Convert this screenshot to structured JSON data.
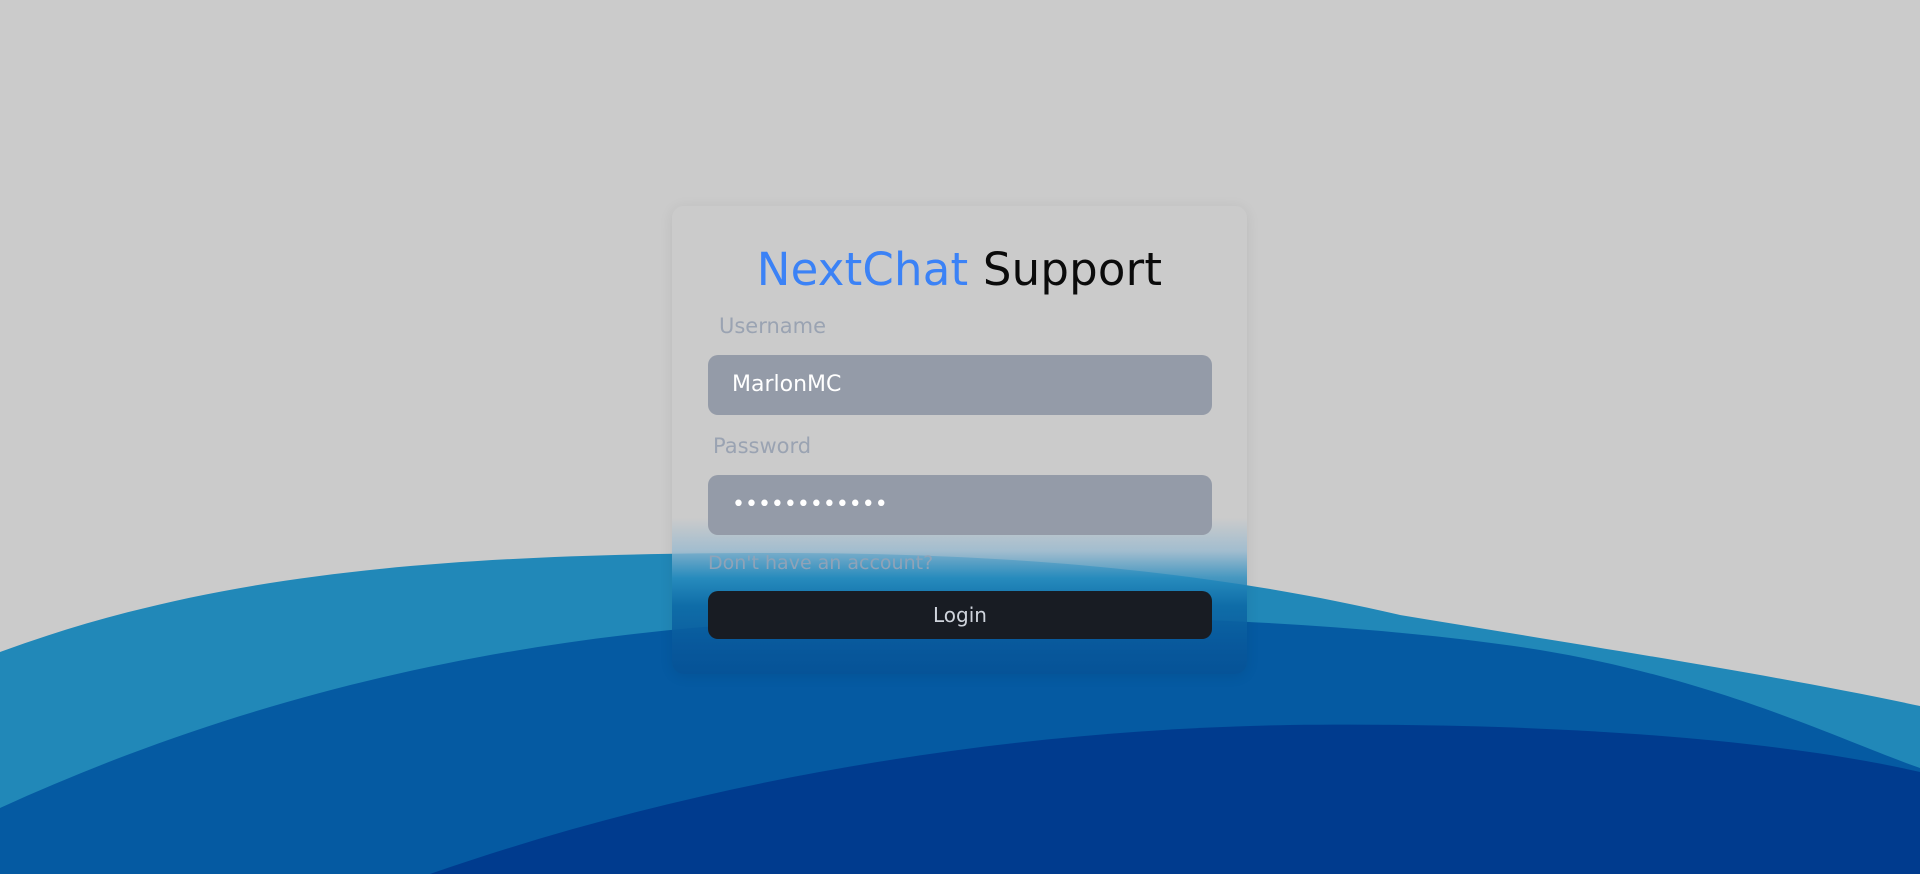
{
  "title": {
    "brand": "NextChat",
    "rest": " Support"
  },
  "form": {
    "username_label": "Username",
    "username_value": "MarlonMC",
    "password_label": "Password",
    "password_value": "••••••••••••",
    "signup_link": "Don't have an account?",
    "login_button": "Login"
  },
  "colors": {
    "background": "#cbcbcb",
    "brand": "#3b82f6",
    "field_bg": "#949ba8",
    "button_bg": "#181c23",
    "wave_light": "#2188b8",
    "wave_mid": "#055aa2",
    "wave_dark": "#003b8e"
  }
}
